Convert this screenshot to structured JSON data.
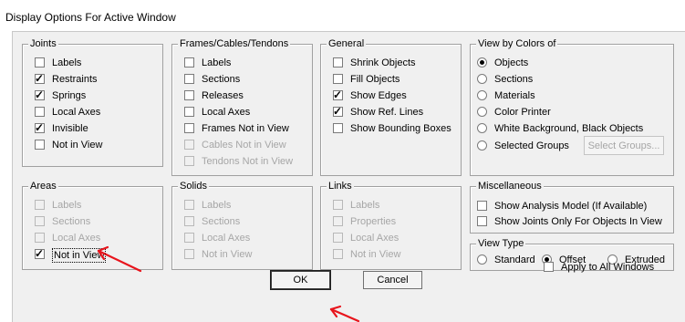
{
  "window": {
    "title": "Display Options For Active Window"
  },
  "groups": {
    "joints": {
      "label": "Joints",
      "items": [
        {
          "label": "Labels",
          "checked": false,
          "enabled": true
        },
        {
          "label": "Restraints",
          "checked": true,
          "enabled": true
        },
        {
          "label": "Springs",
          "checked": true,
          "enabled": true
        },
        {
          "label": "Local Axes",
          "checked": false,
          "enabled": true
        },
        {
          "label": "Invisible",
          "checked": true,
          "enabled": true
        },
        {
          "label": "Not in View",
          "checked": false,
          "enabled": true
        }
      ]
    },
    "frames": {
      "label": "Frames/Cables/Tendons",
      "items": [
        {
          "label": "Labels",
          "checked": false,
          "enabled": true
        },
        {
          "label": "Sections",
          "checked": false,
          "enabled": true
        },
        {
          "label": "Releases",
          "checked": false,
          "enabled": true
        },
        {
          "label": "Local Axes",
          "checked": false,
          "enabled": true
        },
        {
          "label": "Frames Not in View",
          "checked": false,
          "enabled": true
        },
        {
          "label": "Cables Not in View",
          "checked": false,
          "enabled": false
        },
        {
          "label": "Tendons Not in View",
          "checked": false,
          "enabled": false
        }
      ]
    },
    "general": {
      "label": "General",
      "items": [
        {
          "label": "Shrink Objects",
          "checked": false,
          "enabled": true
        },
        {
          "label": "Fill Objects",
          "checked": false,
          "enabled": true
        },
        {
          "label": "Show Edges",
          "checked": true,
          "enabled": true
        },
        {
          "label": "Show Ref. Lines",
          "checked": true,
          "enabled": true
        },
        {
          "label": "Show Bounding Boxes",
          "checked": false,
          "enabled": true
        }
      ]
    },
    "view_by_colors": {
      "label": "View by Colors of",
      "items": [
        {
          "label": "Objects",
          "selected": true
        },
        {
          "label": "Sections",
          "selected": false
        },
        {
          "label": "Materials",
          "selected": false
        },
        {
          "label": "Color Printer",
          "selected": false
        },
        {
          "label": "White Background, Black Objects",
          "selected": false
        },
        {
          "label": "Selected Groups",
          "selected": false
        }
      ],
      "select_groups_button": "Select Groups..."
    },
    "areas": {
      "label": "Areas",
      "items": [
        {
          "label": "Labels",
          "checked": false,
          "enabled": false
        },
        {
          "label": "Sections",
          "checked": false,
          "enabled": false
        },
        {
          "label": "Local Axes",
          "checked": false,
          "enabled": false
        },
        {
          "label": "Not in View",
          "checked": true,
          "enabled": true
        }
      ]
    },
    "solids": {
      "label": "Solids",
      "items": [
        {
          "label": "Labels",
          "checked": false,
          "enabled": false
        },
        {
          "label": "Sections",
          "checked": false,
          "enabled": false
        },
        {
          "label": "Local Axes",
          "checked": false,
          "enabled": false
        },
        {
          "label": "Not in View",
          "checked": false,
          "enabled": false
        }
      ]
    },
    "links": {
      "label": "Links",
      "items": [
        {
          "label": "Labels",
          "checked": false,
          "enabled": false
        },
        {
          "label": "Properties",
          "checked": false,
          "enabled": false
        },
        {
          "label": "Local Axes",
          "checked": false,
          "enabled": false
        },
        {
          "label": "Not in View",
          "checked": false,
          "enabled": false
        }
      ]
    },
    "misc": {
      "label": "Miscellaneous",
      "items": [
        {
          "label": "Show Analysis Model  (If Available)",
          "checked": false,
          "enabled": true
        },
        {
          "label": "Show Joints Only For Objects In View",
          "checked": false,
          "enabled": true
        }
      ]
    },
    "view_type": {
      "label": "View Type",
      "items": [
        {
          "label": "Standard",
          "selected": false
        },
        {
          "label": "Offset",
          "selected": true
        },
        {
          "label": "Extruded",
          "selected": false
        }
      ]
    }
  },
  "apply_all": {
    "label": "Apply to All Windows",
    "checked": false
  },
  "buttons": {
    "ok": "OK",
    "cancel": "Cancel"
  },
  "annotation": {
    "arrow_color": "#e8141c"
  }
}
